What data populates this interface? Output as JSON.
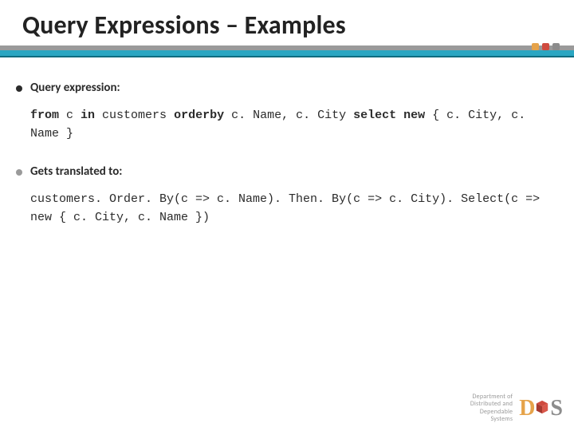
{
  "title": "Query Expressions – Examples",
  "bullets": {
    "b1": "Query expression:",
    "b2": "Gets translated to:"
  },
  "code": {
    "c1": {
      "w1": "from",
      "t1": " c ",
      "w2": "in",
      "t2": " customers ",
      "w3": "orderby",
      "t3": " c. Name, c. City ",
      "w4": "select",
      "t4": " ",
      "w5": "new",
      "t5": " { c. City, c. Name }"
    },
    "c2": "customers. Order. By(c => c. Name). Then. By(c => c. City). Select(c => new { c. City, c. Name })"
  },
  "footer": {
    "dept_l1": "Department of",
    "dept_l2": "Distributed and",
    "dept_l3": "Dependable",
    "dept_l4": "Systems",
    "logo_d": "D",
    "logo_s": "S"
  }
}
